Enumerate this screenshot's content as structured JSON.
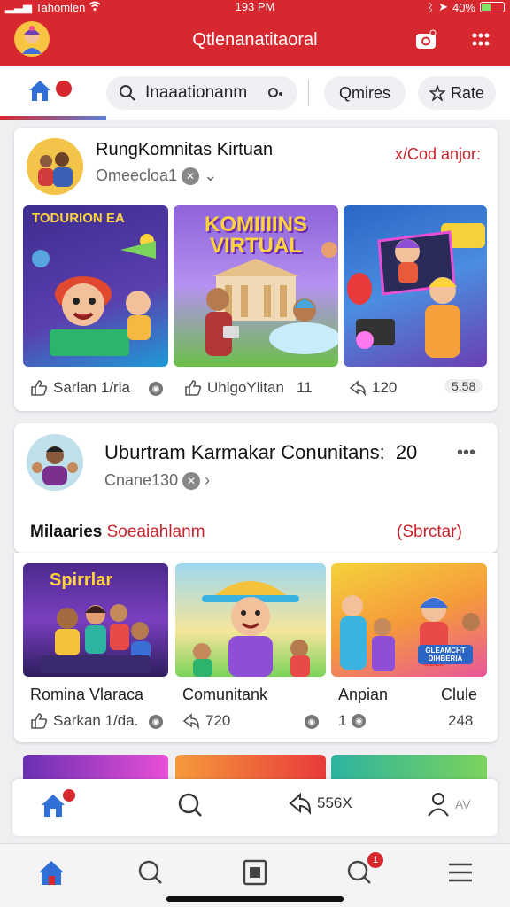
{
  "status_bar": {
    "carrier": "Tahomlen",
    "time": "193 PM",
    "battery": "40%",
    "battery_level": 0.4
  },
  "header": {
    "title": "Qtlenanatitaoral"
  },
  "toolbar": {
    "home_badge": "",
    "search_value": "Inaaationanm",
    "filter_label": "Qmires",
    "rate_label": "Rate"
  },
  "post1": {
    "title": "RungKomnitas Kirtuan",
    "subtitle": "Omeecloa1",
    "action_link": "x/Cod anjor:",
    "thumbs": [
      {
        "caption": "TODURION EA"
      },
      {
        "caption": "KOMIIIINS VIRTUAL"
      },
      {
        "caption": ""
      }
    ],
    "stats": {
      "likes": "Sarlan 1/ria",
      "comments": "UhlgoYlitan",
      "comments_count": "11",
      "shares": "120",
      "views": "5.58"
    }
  },
  "post2": {
    "title": "Uburtram Karmakar Conunitans:",
    "title_count": "20",
    "subtitle": "Cnane130",
    "category": "Milaaries",
    "category_tail": "Soeaiahlanm",
    "action_link": "(Sbrctar)"
  },
  "post3": {
    "thumbs": [
      {
        "caption": "Spirrlar"
      },
      {
        "caption": ""
      },
      {
        "caption": "GLEAMCHT DIHBERIA"
      }
    ],
    "labels": [
      "Romina Vlaraca",
      "Comunitank",
      "Anpian",
      "Clule"
    ],
    "stats": {
      "likes": "Sarkan 1/da.",
      "shares": "720",
      "comments": "1",
      "count": "248"
    }
  },
  "action_bar": {
    "share_count": "556X",
    "profile_label": "AV"
  },
  "bottom_nav": {
    "notif_count": "1",
    "home_badge": ""
  },
  "colors": {
    "brand_red": "#d8282f",
    "accent_blue": "#2f6fd6"
  },
  "icons": [
    "wifi-icon",
    "bluetooth-icon",
    "location-icon",
    "home-icon",
    "search-icon",
    "mic-icon",
    "star-icon",
    "camera-icon",
    "grid-icon",
    "like-icon",
    "share-icon",
    "more-icon",
    "profile-icon",
    "menu-icon",
    "square-icon"
  ]
}
